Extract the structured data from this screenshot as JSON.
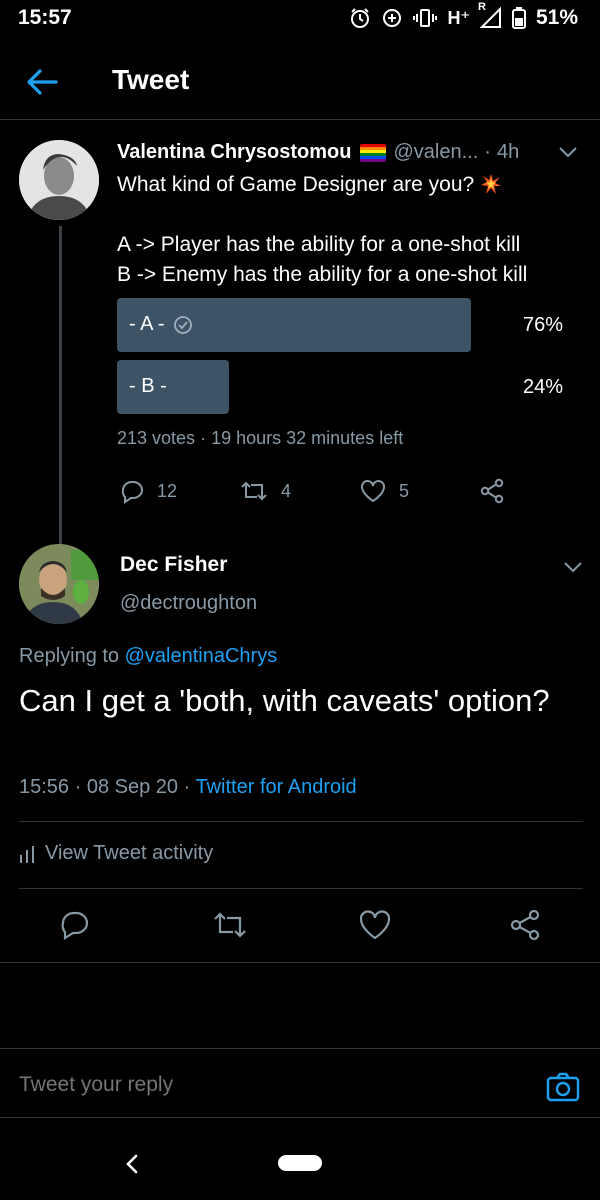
{
  "status_bar": {
    "time": "15:57",
    "network": "H⁺",
    "roaming": "R",
    "battery": "51%"
  },
  "header": {
    "title": "Tweet"
  },
  "parent_tweet": {
    "display_name": "Valentina Chrysostomou",
    "handle": "@valen...",
    "separator": "·",
    "time_ago": "4h",
    "text_lines": [
      "What kind of Game Designer are you?",
      "",
      "A -> Player has the ability for a one-shot kill",
      "B -> Enemy has the ability for a one-shot kill"
    ],
    "poll": {
      "options": [
        {
          "label": "- A -",
          "percent": "76%",
          "fraction": 0.76,
          "selected": true
        },
        {
          "label": "- B -",
          "percent": "24%",
          "fraction": 0.24,
          "selected": false
        }
      ],
      "votes": "213 votes",
      "dot": "·",
      "time_left": "19 hours 32 minutes left"
    },
    "actions": {
      "replies": "12",
      "retweets": "4",
      "likes": "5"
    }
  },
  "main_tweet": {
    "display_name": "Dec Fisher",
    "handle": "@dectroughton",
    "replying_prefix": "Replying to",
    "replying_to": "@valentinaChrys",
    "text": "Can I get a 'both, with caveats' option?",
    "time": "15:56",
    "dot1": "·",
    "date": "08 Sep 20",
    "dot2": "·",
    "source": "Twitter for Android",
    "activity_label": "View Tweet activity"
  },
  "reply_bar": {
    "placeholder": "Tweet your reply"
  },
  "colors": {
    "background": "#000000",
    "accent": "#1da1f2",
    "muted": "#8899a6",
    "poll_bar": "#3d5467",
    "divider": "#2f3336"
  }
}
